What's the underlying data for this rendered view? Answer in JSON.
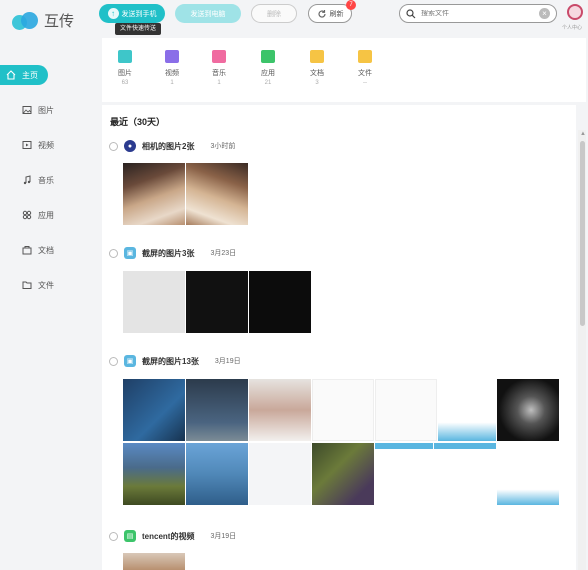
{
  "app": {
    "logo_text": "互传"
  },
  "toolbar": {
    "primary_label": "发送到手机",
    "secondary_label": "发送到电脑",
    "ghost_label": "删除",
    "refresh_label": "刷新",
    "refresh_badge": "7",
    "tooltip": "文件快速传送",
    "search_placeholder": "搜索文件",
    "avatar_label": "个人中心"
  },
  "sidebar": {
    "items": [
      {
        "label": "主页",
        "icon": "home-icon"
      },
      {
        "label": "图片",
        "icon": "image-icon"
      },
      {
        "label": "视频",
        "icon": "video-icon"
      },
      {
        "label": "音乐",
        "icon": "music-icon"
      },
      {
        "label": "应用",
        "icon": "apps-icon"
      },
      {
        "label": "文档",
        "icon": "document-icon"
      },
      {
        "label": "文件",
        "icon": "folder-icon"
      }
    ]
  },
  "categories": [
    {
      "label": "图片",
      "count": "63",
      "color": "#3ec6c9",
      "icon": "image-icon"
    },
    {
      "label": "视频",
      "count": "1",
      "color": "#8a6ee8",
      "icon": "video-icon"
    },
    {
      "label": "音乐",
      "count": "1",
      "color": "#f06ba0",
      "icon": "music-icon"
    },
    {
      "label": "应用",
      "count": "21",
      "color": "#3cc46a",
      "icon": "apps-icon"
    },
    {
      "label": "文档",
      "count": "3",
      "color": "#f6c444",
      "icon": "document-icon"
    },
    {
      "label": "文件",
      "count": "--",
      "color": "#f6c444",
      "icon": "folder-icon"
    }
  ],
  "main": {
    "section_title": "最近（30天）",
    "groups": [
      {
        "title": "相机的图片2张",
        "date": "3小时前",
        "icon_color": "#2b3b8f"
      },
      {
        "title": "截屏的图片3张",
        "date": "3月23日",
        "icon_color": "#5ab6e0"
      },
      {
        "title": "截屏的图片13张",
        "date": "3月19日",
        "icon_color": "#5ab6e0"
      },
      {
        "title": "tencent的视频",
        "date": "3月19日",
        "icon_color": "#3cc46a"
      }
    ]
  },
  "colors": {
    "accent": "#20c0c8",
    "badge": "#ff4545"
  }
}
